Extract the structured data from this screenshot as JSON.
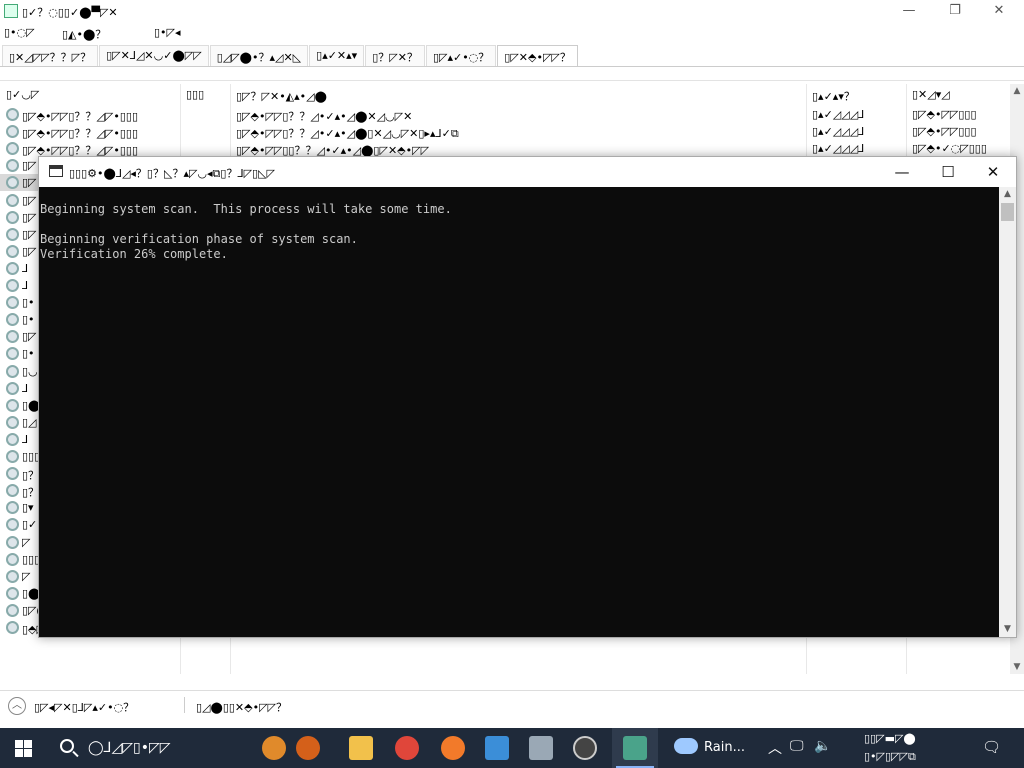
{
  "background_window": {
    "title": "▯✓？◌▯▯✓⬤▀◸✕",
    "menubar": [
      "▯•◌◸",
      "▯◭•⬤？",
      "▯•◸◂"
    ],
    "tabs": [
      {
        "label": "▯✕◿◸◸？？◸？",
        "active": false
      },
      {
        "label": "▯◸✕⅃◿✕◡✓⬤◸◸",
        "active": false
      },
      {
        "label": "▯◿◸⬤•？▴◿✕◺",
        "active": false
      },
      {
        "label": "▯▴✓✕▴▾",
        "active": false
      },
      {
        "label": "▯？◸✕？",
        "active": false
      },
      {
        "label": "▯◸▴✓•◌？",
        "active": false
      },
      {
        "label": "▯◸✕⬘•◸◸？",
        "active": true
      }
    ],
    "columns": [
      "▯✓◡◸",
      "▯▯▯",
      "▯◸？◸✕•◭▴•◿⬤",
      "▯▴✓▴▾？",
      "▯✕◿▾◿"
    ],
    "rows": [
      {
        "c1": "▯◸⬘•◸◸▯？？◿◸•▯▯▯",
        "c2": "",
        "c3": "▯◸⬘•◸◸▯？？◿•✓▴•◿⬤✕◿◡◸✕",
        "c4": "▯▴✓◿◿◿⅃",
        "c5": "▯◸⬘•◸◸▯▯▯",
        "selected": false
      },
      {
        "c1": "▯◸⬘•◸◸▯？？◿◸•▯▯▯",
        "c2": "",
        "c3": "▯◸⬘•◸◸▯？？◿•✓▴•◿⬤▯✕◿◡◸✕▯▸▴⅃✓⧉",
        "c4": "▯▴✓◿◿◿⅃",
        "c5": "▯◸⬘•◸◸▯▯▯",
        "selected": false
      },
      {
        "c1": "▯◸⬘•◸◸▯？？◿◸•▯▯▯",
        "c2": "",
        "c3": "▯◸⬘•◸◸▯▯？？◿•✓▴•◿⬤▯◸✕⬘•◸◸",
        "c4": "▯▴✓◿◿◿⅃",
        "c5": "▯◸⬘•✓◌◸▯▯▯",
        "selected": false
      },
      {
        "c1": "▯◸",
        "c2": "",
        "c3": "",
        "c4": "",
        "c5": "",
        "selected": false
      },
      {
        "c1": "▯◸",
        "c2": "",
        "c3": "",
        "c4": "",
        "c5": "",
        "selected": true
      },
      {
        "c1": "▯◸",
        "c2": "",
        "c3": "",
        "c4": "",
        "c5": "",
        "selected": false
      },
      {
        "c1": "▯◸",
        "c2": "",
        "c3": "",
        "c4": "",
        "c5": "",
        "selected": false
      },
      {
        "c1": "▯◸",
        "c2": "",
        "c3": "",
        "c4": "",
        "c5": "",
        "selected": false
      },
      {
        "c1": "▯◸",
        "c2": "",
        "c3": "",
        "c4": "",
        "c5": "",
        "selected": false
      },
      {
        "c1": "⅃",
        "c2": "",
        "c3": "",
        "c4": "",
        "c5": "",
        "selected": false
      },
      {
        "c1": "⅃",
        "c2": "",
        "c3": "",
        "c4": "",
        "c5": "",
        "selected": false
      },
      {
        "c1": "▯•",
        "c2": "",
        "c3": "",
        "c4": "",
        "c5": "",
        "selected": false
      },
      {
        "c1": "▯•",
        "c2": "",
        "c3": "",
        "c4": "",
        "c5": "",
        "selected": false
      },
      {
        "c1": "▯◸",
        "c2": "",
        "c3": "",
        "c4": "",
        "c5": "",
        "selected": false
      },
      {
        "c1": "▯•",
        "c2": "",
        "c3": "",
        "c4": "",
        "c5": "",
        "selected": false
      },
      {
        "c1": "▯◡",
        "c2": "",
        "c3": "",
        "c4": "",
        "c5": "",
        "selected": false
      },
      {
        "c1": "⅃",
        "c2": "",
        "c3": "",
        "c4": "",
        "c5": "",
        "selected": false
      },
      {
        "c1": "▯⬤",
        "c2": "",
        "c3": "",
        "c4": "",
        "c5": "",
        "selected": false
      },
      {
        "c1": "▯◿",
        "c2": "",
        "c3": "",
        "c4": "",
        "c5": "",
        "selected": false
      },
      {
        "c1": "⅃",
        "c2": "",
        "c3": "",
        "c4": "",
        "c5": "",
        "selected": false
      },
      {
        "c1": "▯▯▯",
        "c2": "",
        "c3": "",
        "c4": "",
        "c5": "",
        "selected": false
      },
      {
        "c1": "▯？",
        "c2": "",
        "c3": "",
        "c4": "",
        "c5": "",
        "selected": false
      },
      {
        "c1": "▯？",
        "c2": "",
        "c3": "",
        "c4": "",
        "c5": "",
        "selected": false
      },
      {
        "c1": "▯▾",
        "c2": "",
        "c3": "",
        "c4": "",
        "c5": "",
        "selected": false
      },
      {
        "c1": "▯✓",
        "c2": "",
        "c3": "",
        "c4": "",
        "c5": "",
        "selected": false
      },
      {
        "c1": "◸",
        "c2": "",
        "c3": "",
        "c4": "",
        "c5": "",
        "selected": false
      },
      {
        "c1": "▯▯▯",
        "c2": "",
        "c3": "",
        "c4": "",
        "c5": "",
        "selected": false
      },
      {
        "c1": "◸",
        "c2": "",
        "c3": "",
        "c4": "",
        "c5": "",
        "selected": false
      },
      {
        "c1": "▯⬤",
        "c2": "",
        "c3": "",
        "c4": "",
        "c5": "",
        "selected": false
      },
      {
        "c1": "▯◸⬤•◭▀",
        "c2": "◸▯▯▯",
        "c3": "⬘◭•⬤◸⅃⬘•⬤▯✕◸⬤◸▀",
        "c4": "▯▴⬤⬤◿▀",
        "c5": "▯◭▾⅃◿◸◸▯▯▯",
        "selected": false
      },
      {
        "c1": "▯⬘◸⬤•◭？▴◸◡",
        "c2": "◸▯▯▯",
        "c3": "▯▯▯▯▯⬘•◸⬤▴◭？▴◸◡",
        "c4": "▯▾⬤⬤◿▀",
        "c5": "▯◭▾◌◸◸▯▯▯",
        "selected": false
      }
    ],
    "status_left": "▯◸◂◸✕▯⅃◸▴✓•◌？",
    "status_right": "▯◿⬤▯▯✕⬘•◸◸？"
  },
  "console": {
    "title": "▯▯▯⚙•⬤⅃◿◂？▯？◺？▴◸◡◂⧉▯？⅃◸▯◺◸",
    "lines": [
      "Beginning system scan.  This process will take some time.",
      "",
      "Beginning verification phase of system scan.",
      "Verification 26% complete."
    ],
    "verification_progress_percent": 26
  },
  "taskbar": {
    "search_placeholder": "◯⅃◿◸▯•◸◸",
    "weather_label": "Rain...",
    "tray_time": "▯▯◸▬◸⬤",
    "tray_date": "▯•◸▯◸◸⧉"
  },
  "colors": {
    "console_bg": "#0c0c0c",
    "console_fg": "#cccccc",
    "taskbar_bg": "#1f2a3a",
    "selection": "#d9d9d9"
  }
}
